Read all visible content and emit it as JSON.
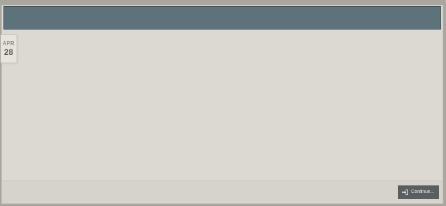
{
  "post": {
    "date": {
      "month": "APR",
      "day": "28"
    }
  },
  "footer": {
    "continue_label": "Continue..."
  },
  "icons": {
    "continue_icon": "sign-in-icon"
  },
  "colors": {
    "header_bar": "#5e727c",
    "card_background": "#dcd9d3",
    "page_background": "#a9a6a0",
    "button_background": "#5a5e61"
  }
}
